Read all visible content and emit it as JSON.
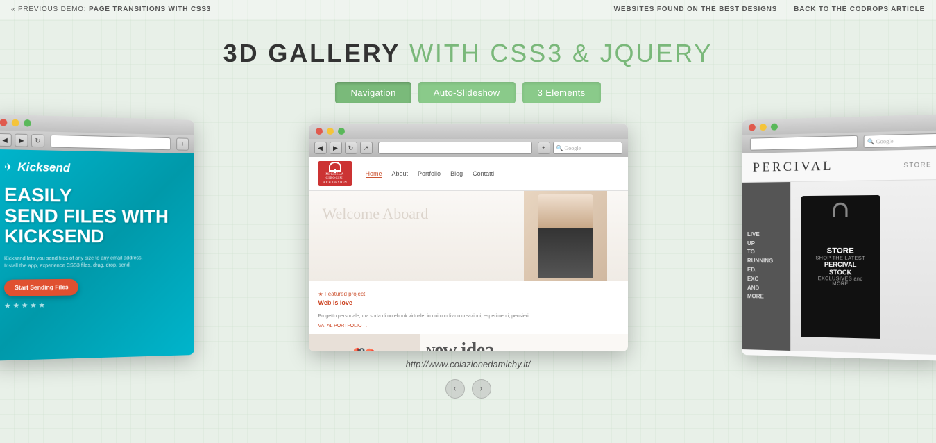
{
  "topbar": {
    "left_label": "« Previous Demo:",
    "left_link": "Page Transitions with CSS3",
    "right_links": [
      {
        "label": "Websites Found on the Best Designs",
        "id": "best-designs-link"
      },
      {
        "label": "Back to the Codrops Article",
        "id": "codrops-link"
      }
    ]
  },
  "title": {
    "bold": "3D Gallery",
    "light": "with CSS3 & jQuery"
  },
  "buttons": [
    {
      "label": "Navigation",
      "state": "active",
      "id": "nav-btn"
    },
    {
      "label": "Auto-Slideshow",
      "state": "inactive",
      "id": "slideshow-btn"
    },
    {
      "label": "3 Elements",
      "state": "inactive",
      "id": "elements-btn"
    }
  ],
  "gallery": {
    "caption": "http://www.colazionedamichy.it/",
    "center_site": {
      "nav_links": [
        "Home",
        "About",
        "Portfolio",
        "Blog",
        "Contatti"
      ],
      "hero_text": "Welcome Aboard",
      "featured_title": "Featured project",
      "featured_link": "Web is love",
      "featured_desc": "Progetto personale,una sorta di notebook virtuale, in cui condivido creazioni, esperimenti, pensieri.",
      "portfolio_btn": "VAI AL PORTFOLIO →",
      "bottom_label": "New idea"
    },
    "left_site": {
      "logo": "Kicksend",
      "headline": "Easily\nSend Files with\nKicksend",
      "button": "Start Sending Files",
      "stars": "★ ★ ★ ★ ★"
    },
    "right_site": {
      "logo": "PERCIVAL",
      "store_link": "STORE",
      "badge_main": "STORE",
      "badge_sub1": "SHOP THE LATEST",
      "badge_sub2": "PERCIVAL STOCK",
      "badge_sub3": "EXCLUSIVES and MORE"
    }
  },
  "arrows": {
    "prev": "‹",
    "next": "›"
  }
}
